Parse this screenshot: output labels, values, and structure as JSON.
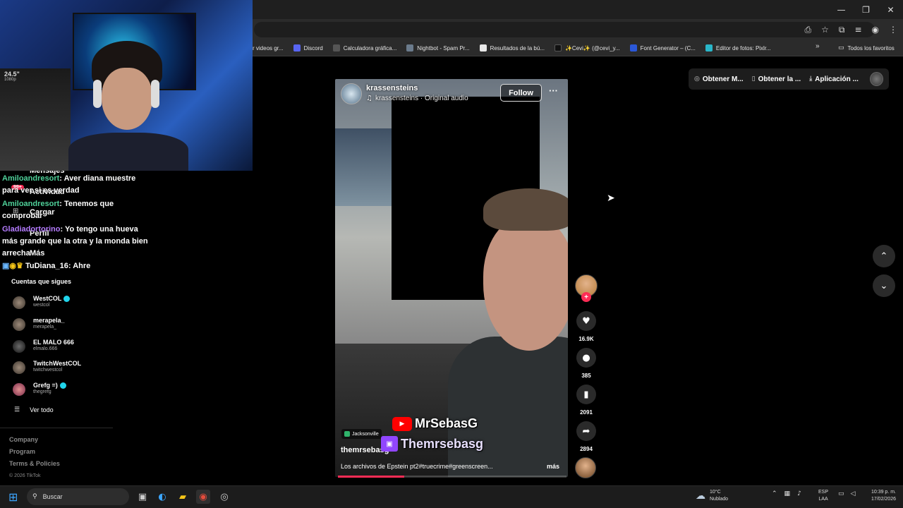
{
  "browser": {
    "window_controls": [
      "—",
      "❐",
      "✕"
    ],
    "bookmarks": [
      {
        "label": "r videos gr...",
        "icon": "page-icon",
        "color": "#666666"
      },
      {
        "label": "Discord",
        "icon": "discord-icon",
        "color": "#5865f2"
      },
      {
        "label": "Calculadora gráfica...",
        "icon": "calculator-icon",
        "color": "#555555"
      },
      {
        "label": "Nightbot - Spam Pr...",
        "icon": "nightbot-icon",
        "color": "#6b7b8c"
      },
      {
        "label": "Resultados de la bú...",
        "icon": "search-results-icon",
        "color": "#e8e8e8"
      },
      {
        "label": "✨Cevi✨ (@cevi_y...",
        "icon": "tiktok-icon",
        "color": "#111111"
      },
      {
        "label": "Font Generator – (C...",
        "icon": "font-icon",
        "color": "#2b58d8"
      },
      {
        "label": "Editor de fotos: Pixlr...",
        "icon": "pixlr-icon",
        "color": "#29b6c9"
      }
    ],
    "bookmarks_more": "»",
    "all_bookmarks": "Todos los favoritos"
  },
  "top_bar": {
    "get_app_label": "Obtener M...",
    "get_desktop_label": "Obtener la ...",
    "app_label": "Aplicación ..."
  },
  "sidebar": {
    "messages": "Mensajes",
    "activity": "Actividad",
    "activity_badge": "99+",
    "upload": "Cargar",
    "profile": "Perfil",
    "more": "Más",
    "following_title": "Cuentas que sigues",
    "accounts": [
      {
        "name": "WestCOL",
        "handle": "westcol",
        "verified": true
      },
      {
        "name": "merapela_",
        "handle": "merapela_",
        "verified": false
      },
      {
        "name": "EL MALO 666",
        "handle": "elmalo.666",
        "verified": false
      },
      {
        "name": "TwitchWestCOL",
        "handle": "twitchwestcol",
        "verified": false
      },
      {
        "name": "Grefg =)",
        "handle": "thegrefg",
        "verified": true
      }
    ],
    "see_all": "Ver todo",
    "footer_links": [
      "Company",
      "Program",
      "Terms & Policies"
    ],
    "copyright": "© 2026 TikTok"
  },
  "webcam": {
    "monitor_text": "24.5\"",
    "monitor_subtext": "1080p"
  },
  "chat": [
    {
      "user": "Amiloandresort",
      "text": ": Aver diana muestre para ver si es verdad",
      "color": "#4fd19a"
    },
    {
      "user": "Amiloandresort",
      "text": ": Tenemos que comprobar",
      "color": "#4fd19a"
    },
    {
      "user": "Gladiadortorino",
      "text": ": Yo tengo una hueva más grande que la otra y la monda bien arrecha",
      "color": "#b57cff"
    },
    {
      "user": "TuDiana_16",
      "text": ": Ahre",
      "color": "#ffffff"
    }
  ],
  "video": {
    "user": "krassensteins",
    "audio": "krassensteins · Original audio",
    "follow": "Follow",
    "more": "···",
    "location": "Jacksonville",
    "author": "themrsebasg",
    "caption": "Los archivos de Epstein pt2#truecrime#greenscreen...",
    "caption_more": "más",
    "progress": 0.29
  },
  "stream_overlay": {
    "youtube_name": "MrSebasG",
    "twitch_name": "Themrsebasg"
  },
  "actions": {
    "likes": "16.9K",
    "comments": "385",
    "saves": "2091",
    "shares": "2894"
  },
  "taskbar": {
    "search": "Buscar",
    "weather_temp": "10°C",
    "weather_desc": "Nublado",
    "lang_1": "ESP",
    "lang_2": "LAA",
    "time": "10:39 p. m.",
    "date": "17/02/2026"
  }
}
